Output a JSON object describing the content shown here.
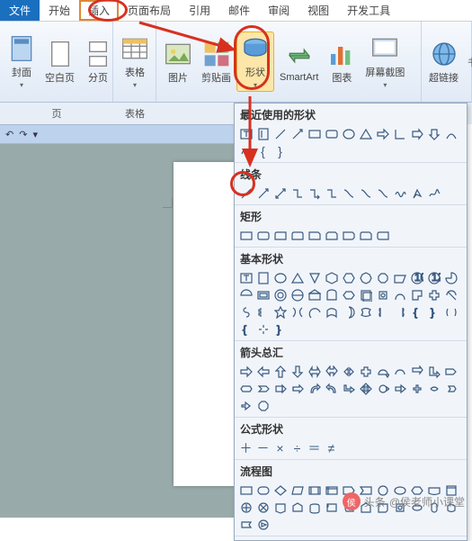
{
  "menu": {
    "file": "文件",
    "tabs": [
      "开始",
      "插入",
      "页面布局",
      "引用",
      "邮件",
      "审阅",
      "视图",
      "开发工具"
    ],
    "active_index": 1
  },
  "ribbon": {
    "groups": {
      "pages": {
        "label": "页",
        "items": [
          "封面",
          "空白页",
          "分页"
        ]
      },
      "tables": {
        "label": "表格",
        "items": [
          "表格"
        ]
      },
      "illustrations": {
        "label": "",
        "items": [
          "图片",
          "剪贴画",
          "形状",
          "SmartArt",
          "图表",
          "屏幕截图"
        ]
      },
      "links": {
        "label": "",
        "items": [
          "超链接",
          "书"
        ]
      }
    }
  },
  "shapes": {
    "sections": {
      "recent": {
        "title": "最近使用的形状"
      },
      "lines": {
        "title": "线条"
      },
      "rectangles": {
        "title": "矩形"
      },
      "basic": {
        "title": "基本形状"
      },
      "arrows": {
        "title": "箭头总汇"
      },
      "equation": {
        "title": "公式形状"
      },
      "flowchart": {
        "title": "流程图"
      }
    }
  },
  "colors": {
    "accent": "#1a6fbf",
    "highlight_border": "#d83020"
  },
  "watermark": {
    "source_label": "头条",
    "author": "@侯老师小课堂"
  }
}
